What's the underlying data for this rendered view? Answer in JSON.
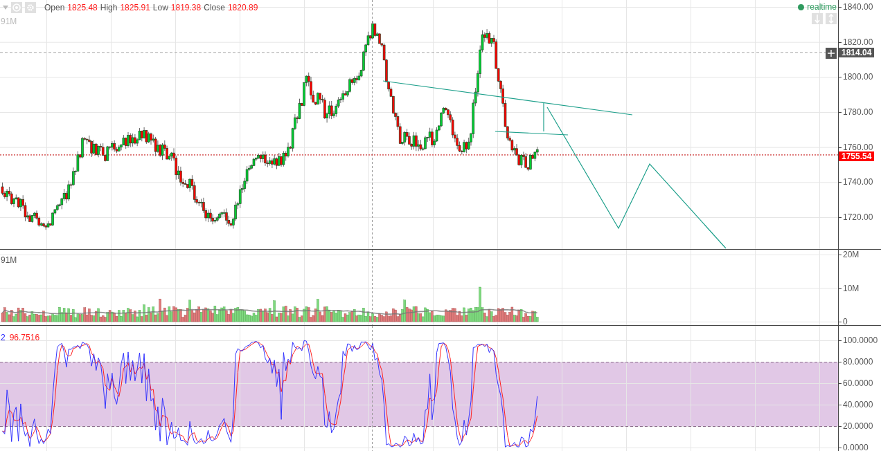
{
  "legend": [
    {
      "label": "Open",
      "value": "1825.48"
    },
    {
      "label": "High",
      "value": "1825.91"
    },
    {
      "label": "Low",
      "value": "1819.38"
    },
    {
      "label": "Close",
      "value": "1820.89"
    }
  ],
  "realtime": {
    "label": "realtime"
  },
  "main_pane": {
    "label": "91M"
  },
  "price_axis": {
    "ticks": [
      "1840.00",
      "1820.00",
      "1800.00",
      "1780.00",
      "1760.00",
      "1740.00",
      "1720.00"
    ],
    "markers": [
      {
        "kind": "crosshair",
        "value": "1814.04"
      },
      {
        "kind": "last",
        "value": "1755.54"
      }
    ]
  },
  "volume_pane": {
    "label": "91M",
    "ticks": [
      "20M",
      "10M",
      "0"
    ]
  },
  "stochastic_pane": {
    "legend": [
      {
        "kind": "k",
        "value": "2"
      },
      {
        "kind": "d",
        "value": "96.7516"
      }
    ],
    "ticks": [
      "100.0000",
      "80.0000",
      "60.0000",
      "40.0000",
      "20.0000",
      "0.0000"
    ]
  }
}
